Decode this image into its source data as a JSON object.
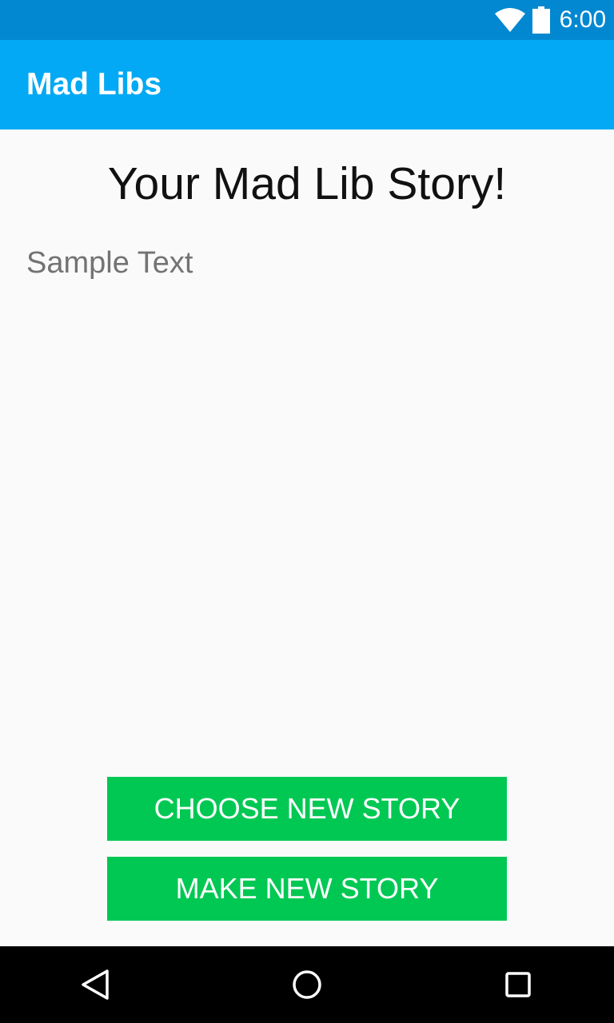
{
  "status_bar": {
    "time": "6:00",
    "icons": [
      "wifi-icon",
      "battery-icon"
    ]
  },
  "app_bar": {
    "title": "Mad Libs",
    "color": "#03a9f4"
  },
  "content": {
    "heading": "Your Mad Lib Story!",
    "story_text": "Sample Text"
  },
  "buttons": {
    "choose_new_story": "CHOOSE NEW STORY",
    "make_new_story": "MAKE NEW STORY",
    "color": "#00c853"
  },
  "nav_bar": {
    "icons": [
      "back-icon",
      "home-icon",
      "recents-icon"
    ]
  }
}
